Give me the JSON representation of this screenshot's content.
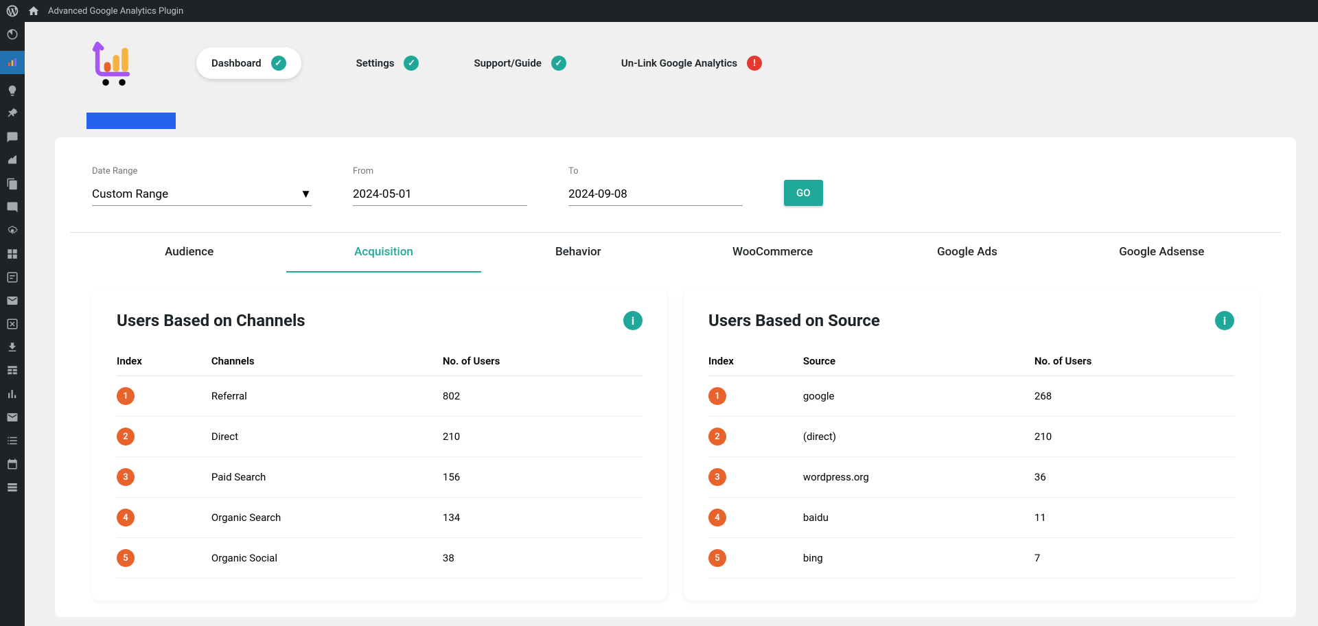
{
  "adminBar": {
    "title": "Advanced Google Analytics Plugin"
  },
  "topNav": {
    "dashboard": "Dashboard",
    "settings": "Settings",
    "support": "Support/Guide",
    "unlink": "Un-Link Google Analytics"
  },
  "dateRow": {
    "rangeLabel": "Date Range",
    "rangeValue": "Custom Range",
    "fromLabel": "From",
    "fromValue": "2024-05-01",
    "toLabel": "To",
    "toValue": "2024-09-08",
    "goLabel": "GO"
  },
  "tabs": {
    "audience": "Audience",
    "acquisition": "Acquisition",
    "behavior": "Behavior",
    "woo": "WooCommerce",
    "gads": "Google Ads",
    "gadsense": "Google Adsense"
  },
  "channelsCard": {
    "title": "Users Based on Channels",
    "col1": "Index",
    "col2": "Channels",
    "col3": "No. of Users",
    "rows": [
      {
        "idx": "1",
        "name": "Referral",
        "users": "802"
      },
      {
        "idx": "2",
        "name": "Direct",
        "users": "210"
      },
      {
        "idx": "3",
        "name": "Paid Search",
        "users": "156"
      },
      {
        "idx": "4",
        "name": "Organic Search",
        "users": "134"
      },
      {
        "idx": "5",
        "name": "Organic Social",
        "users": "38"
      }
    ]
  },
  "sourceCard": {
    "title": "Users Based on Source",
    "col1": "Index",
    "col2": "Source",
    "col3": "No. of Users",
    "rows": [
      {
        "idx": "1",
        "name": "google",
        "users": "268"
      },
      {
        "idx": "2",
        "name": "(direct)",
        "users": "210"
      },
      {
        "idx": "3",
        "name": "wordpress.org",
        "users": "36"
      },
      {
        "idx": "4",
        "name": "baidu",
        "users": "11"
      },
      {
        "idx": "5",
        "name": "bing",
        "users": "7"
      }
    ]
  }
}
